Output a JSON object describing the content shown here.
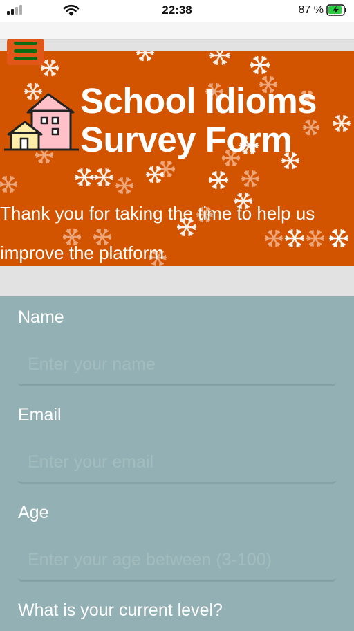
{
  "status_bar": {
    "time": "22:38",
    "battery_percent": "87 %",
    "battery_level": 0.87,
    "charging": true,
    "icons": [
      "signal-icon",
      "wifi-icon",
      "battery-charging-icon"
    ]
  },
  "menu": {
    "icon": "hamburger-menu-icon"
  },
  "header": {
    "title_line1": "School Idioms",
    "title_line2": "Survey Form",
    "description": "Thank you for taking the time to help us improve the platform",
    "logo_icon": "house-icon",
    "colors": {
      "banner": "#d35400",
      "menu_bars": "#0c6b13"
    }
  },
  "form": {
    "background": "#93b1b4",
    "name": {
      "label": "Name",
      "placeholder": "Enter your name"
    },
    "email": {
      "label": "Email",
      "placeholder": "Enter your email"
    },
    "age": {
      "label": "Age",
      "placeholder": "Enter your age between (3-100)"
    },
    "level": {
      "label": "What is your current level?"
    }
  }
}
